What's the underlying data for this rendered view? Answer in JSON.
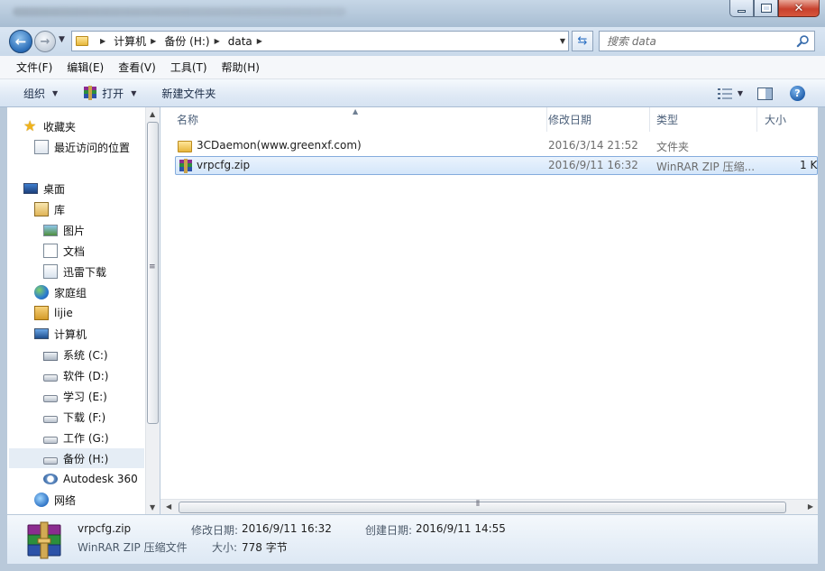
{
  "window": {
    "controls": {
      "minimize": "",
      "maximize": "",
      "close": "✕"
    }
  },
  "address": {
    "crumbs": [
      "计算机",
      "备份 (H:)",
      "data"
    ],
    "search_placeholder": "搜索 data"
  },
  "menu": [
    "文件(F)",
    "编辑(E)",
    "查看(V)",
    "工具(T)",
    "帮助(H)"
  ],
  "commands": {
    "organize": "组织",
    "open": "打开",
    "new_folder": "新建文件夹"
  },
  "nav": {
    "favorites": "收藏夹",
    "recent": "最近访问的位置",
    "desktop": "桌面",
    "libraries": "库",
    "pictures": "图片",
    "documents": "文档",
    "thunder": "迅雷下载",
    "homegroup": "家庭组",
    "user": "lijie",
    "computer": "计算机",
    "drive_c": "系统 (C:)",
    "drive_d": "软件 (D:)",
    "drive_e": "学习 (E:)",
    "drive_f": "下载 (F:)",
    "drive_g": "工作 (G:)",
    "drive_h": "备份 (H:)",
    "autodesk": "Autodesk 360",
    "network": "网络"
  },
  "columns": {
    "name": "名称",
    "modified": "修改日期",
    "type": "类型",
    "size": "大小"
  },
  "files": [
    {
      "name": "3CDaemon(www.greenxf.com)",
      "modified": "2016/3/14 21:52",
      "type": "文件夹",
      "size": ""
    },
    {
      "name": "vrpcfg.zip",
      "modified": "2016/9/11 16:32",
      "type": "WinRAR ZIP 压缩...",
      "size": "1 K"
    }
  ],
  "details": {
    "name": "vrpcfg.zip",
    "type": "WinRAR ZIP 压缩文件",
    "modified_label": "修改日期:",
    "modified_value": "2016/9/11 16:32",
    "created_label": "创建日期:",
    "created_value": "2016/9/11 14:55",
    "size_label": "大小:",
    "size_value": "778 字节"
  }
}
